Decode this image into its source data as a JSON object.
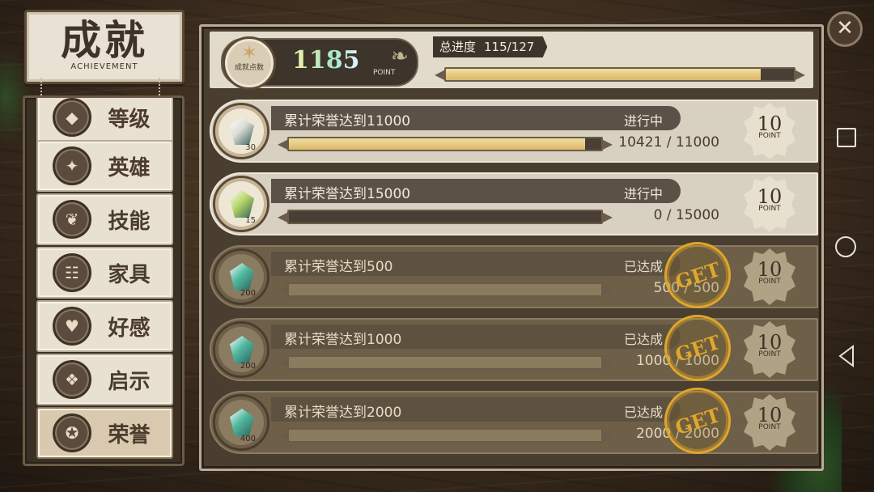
{
  "header": {
    "title": "成就",
    "subtitle": "ACHIEVEMENT"
  },
  "sidebar": {
    "items": [
      {
        "label": "等级",
        "icon": "level-icon",
        "active": false
      },
      {
        "label": "英雄",
        "icon": "hero-icon",
        "active": false
      },
      {
        "label": "技能",
        "icon": "skill-icon",
        "active": false
      },
      {
        "label": "家具",
        "icon": "furniture-icon",
        "active": false
      },
      {
        "label": "好感",
        "icon": "hearts-icon",
        "active": false
      },
      {
        "label": "启示",
        "icon": "revelation-icon",
        "active": false
      },
      {
        "label": "荣誉",
        "icon": "honor-icon",
        "active": true
      }
    ]
  },
  "summary": {
    "points_label": "成就点数",
    "points_value": "1185",
    "points_unit": "POINT",
    "progress_label": "总进度",
    "progress_value": "115/127",
    "progress_current": 115,
    "progress_total": 127
  },
  "achievements": [
    {
      "title": "累计荣誉达到11000",
      "status": "进行中",
      "progress_text": "10421 / 11000",
      "current": 10421,
      "target": 11000,
      "points": "10",
      "points_unit": "POINT",
      "item_qty": "30",
      "gem_color": "#dcdcd6",
      "completed": false
    },
    {
      "title": "累计荣誉达到15000",
      "status": "进行中",
      "progress_text": "0 / 15000",
      "current": 0,
      "target": 15000,
      "points": "10",
      "points_unit": "POINT",
      "item_qty": "15",
      "gem_color": "#b9d66a",
      "completed": false
    },
    {
      "title": "累计荣誉达到500",
      "status": "已达成",
      "progress_text": "500 / 500",
      "current": 500,
      "target": 500,
      "points": "10",
      "points_unit": "POINT",
      "item_qty": "200",
      "gem_color": "#4fb9a0",
      "completed": true,
      "stamp": "GET"
    },
    {
      "title": "累计荣誉达到1000",
      "status": "已达成",
      "progress_text": "1000 / 1000",
      "current": 1000,
      "target": 1000,
      "points": "10",
      "points_unit": "POINT",
      "item_qty": "200",
      "gem_color": "#4fb9a0",
      "completed": true,
      "stamp": "GET"
    },
    {
      "title": "累计荣誉达到2000",
      "status": "已达成",
      "progress_text": "2000 / 2000",
      "current": 2000,
      "target": 2000,
      "points": "10",
      "points_unit": "POINT",
      "item_qty": "400",
      "gem_color": "#4fb9a0",
      "completed": true,
      "stamp": "GET"
    }
  ],
  "colors": {
    "bar_fill": "#e6c778",
    "stamp": "#e0a72a"
  }
}
